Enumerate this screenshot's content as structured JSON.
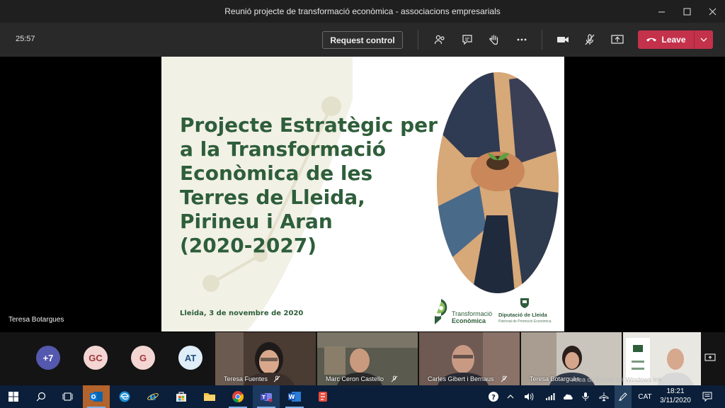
{
  "window": {
    "title": "Reunió projecte de transformació econòmica - associacions empresarials"
  },
  "toolbar": {
    "timer": "25:57",
    "request_control_label": "Request control",
    "leave_label": "Leave",
    "icons": [
      "participants-icon",
      "chat-icon",
      "raise-hand-icon",
      "more-icon",
      "camera-icon",
      "mic-muted-icon",
      "share-icon"
    ]
  },
  "slide": {
    "title_lines": [
      "Projecte Estratègic per",
      "a la Transformació",
      "Econòmica de les",
      "Terres de Lleida,",
      "Pirineu i Aran",
      "(2020-2027)"
    ],
    "date": "Lleida, 3 de novembre de 2020",
    "logo_te_line1": "Transformació",
    "logo_te_line2": "Econòmica",
    "logo_dip_line1": "Diputació de Lleida",
    "logo_dip_line2": "Patronat de Promoció Econòmica"
  },
  "presenter": "Teresa Botargues",
  "participants": {
    "overflow": "+7",
    "avatars": [
      {
        "initials": "GC",
        "bg": "#f3d6d3",
        "fg": "#a4373a"
      },
      {
        "initials": "G",
        "bg": "#f3d6d3",
        "fg": "#a4373a"
      },
      {
        "initials": "AT",
        "bg": "#dfeef9",
        "fg": "#1f4e79"
      }
    ],
    "tiles": [
      {
        "name": "Teresa Fuentes"
      },
      {
        "name": "Marc Ceron Castello"
      },
      {
        "name": "Carles Gibert i Bernaus"
      },
      {
        "name": "Teresa Botargues"
      }
    ]
  },
  "overlay_text": "Àrea de treball del Windows Ink",
  "taskbar": {
    "lang": "CAT",
    "time": "18:21",
    "date": "3/11/2020"
  },
  "colors": {
    "leave": "#c4314b",
    "slide_green": "#2e5e3a",
    "taskbar": "#0b1f3a"
  }
}
